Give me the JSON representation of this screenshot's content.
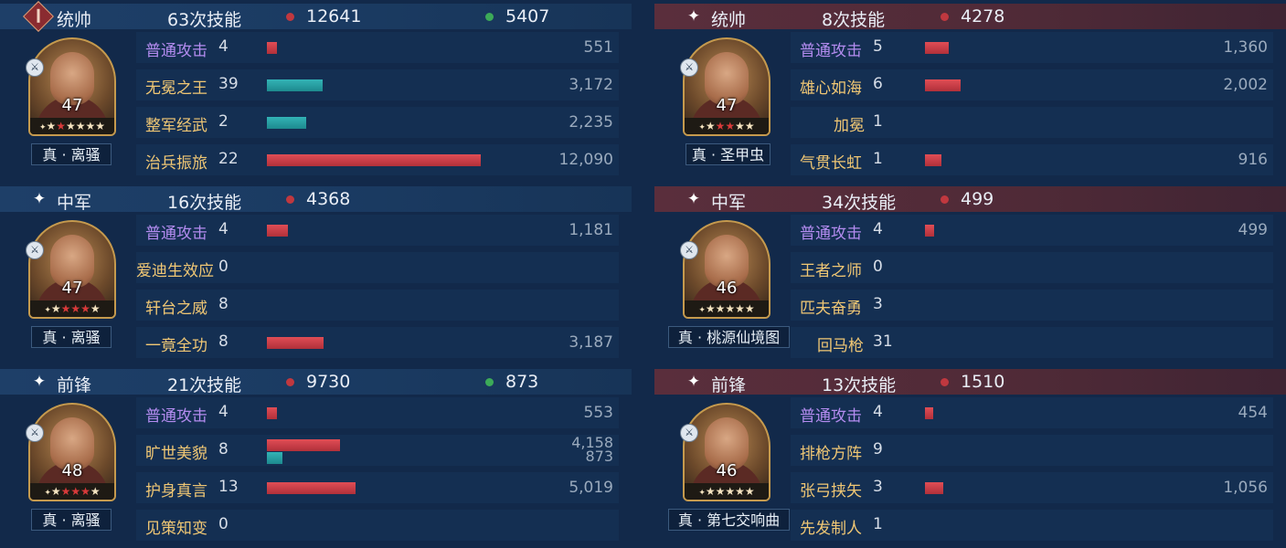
{
  "left": {
    "sections": [
      {
        "role": "统帅",
        "skill_count": "63次技能",
        "damage": "12641",
        "heal": "5407",
        "general": {
          "name": "真 · 离骚",
          "level": "47",
          "stars_red": 1,
          "stars_total": 6
        },
        "skills": [
          {
            "name": "普通攻击",
            "count": "4",
            "kind": "normal",
            "bars": [
              {
                "color": "red",
                "value": 551
              }
            ],
            "values": [
              "551"
            ]
          },
          {
            "name": "无冕之王",
            "count": "39",
            "kind": "tactic",
            "bars": [
              {
                "color": "teal",
                "value": 3172
              }
            ],
            "values": [
              "3,172"
            ]
          },
          {
            "name": "整军经武",
            "count": "2",
            "kind": "tactic",
            "bars": [
              {
                "color": "teal",
                "value": 2235
              }
            ],
            "values": [
              "2,235"
            ]
          },
          {
            "name": "治兵振旅",
            "count": "22",
            "kind": "tactic",
            "bars": [
              {
                "color": "red",
                "value": 12090
              }
            ],
            "values": [
              "12,090"
            ]
          }
        ]
      },
      {
        "role": "中军",
        "skill_count": "16次技能",
        "damage": "4368",
        "heal": "",
        "general": {
          "name": "真 · 离骚",
          "level": "47",
          "stars_red": 3,
          "stars_total": 5
        },
        "skills": [
          {
            "name": "普通攻击",
            "count": "4",
            "kind": "normal",
            "bars": [
              {
                "color": "red",
                "value": 1181
              }
            ],
            "values": [
              "1,181"
            ]
          },
          {
            "name": "爱迪生效应",
            "count": "0",
            "kind": "tactic",
            "bars": [],
            "values": []
          },
          {
            "name": "轩台之威",
            "count": "8",
            "kind": "tactic",
            "bars": [],
            "values": []
          },
          {
            "name": "一竟全功",
            "count": "8",
            "kind": "tactic",
            "bars": [
              {
                "color": "red",
                "value": 3187
              }
            ],
            "values": [
              "3,187"
            ]
          }
        ]
      },
      {
        "role": "前锋",
        "skill_count": "21次技能",
        "damage": "9730",
        "heal": "873",
        "general": {
          "name": "真 · 离骚",
          "level": "48",
          "stars_red": 3,
          "stars_total": 5
        },
        "skills": [
          {
            "name": "普通攻击",
            "count": "4",
            "kind": "normal",
            "bars": [
              {
                "color": "red",
                "value": 553
              }
            ],
            "values": [
              "553"
            ]
          },
          {
            "name": "旷世美貌",
            "count": "8",
            "kind": "tactic",
            "bars": [
              {
                "color": "red",
                "value": 4158
              },
              {
                "color": "teal",
                "value": 873
              }
            ],
            "values": [
              "4,158",
              "873"
            ]
          },
          {
            "name": "护身真言",
            "count": "13",
            "kind": "tactic",
            "bars": [
              {
                "color": "red",
                "value": 5019
              }
            ],
            "values": [
              "5,019"
            ]
          },
          {
            "name": "见策知变",
            "count": "0",
            "kind": "tactic",
            "bars": [],
            "values": []
          }
        ]
      }
    ]
  },
  "right": {
    "sections": [
      {
        "role": "统帅",
        "skill_count": "8次技能",
        "damage": "4278",
        "heal": "",
        "general": {
          "name": "真 · 圣甲虫",
          "level": "47",
          "stars_red": 2,
          "stars_total": 5
        },
        "skills": [
          {
            "name": "普通攻击",
            "count": "5",
            "kind": "normal",
            "bars": [
              {
                "color": "red",
                "value": 1360
              }
            ],
            "values": [
              "1,360"
            ]
          },
          {
            "name": "雄心如海",
            "count": "6",
            "kind": "tactic",
            "bars": [
              {
                "color": "red",
                "value": 2002
              }
            ],
            "values": [
              "2,002"
            ]
          },
          {
            "name": "加冕",
            "count": "1",
            "kind": "tactic",
            "bars": [],
            "values": []
          },
          {
            "name": "气贯长虹",
            "count": "1",
            "kind": "tactic",
            "bars": [
              {
                "color": "red",
                "value": 916
              }
            ],
            "values": [
              "916"
            ]
          }
        ]
      },
      {
        "role": "中军",
        "skill_count": "34次技能",
        "damage": "499",
        "heal": "",
        "general": {
          "name": "真 · 桃源仙境图",
          "level": "46",
          "stars_red": 0,
          "stars_total": 5
        },
        "skills": [
          {
            "name": "普通攻击",
            "count": "4",
            "kind": "normal",
            "bars": [
              {
                "color": "red",
                "value": 499
              }
            ],
            "values": [
              "499"
            ]
          },
          {
            "name": "王者之师",
            "count": "0",
            "kind": "tactic",
            "bars": [],
            "values": []
          },
          {
            "name": "匹夫奋勇",
            "count": "3",
            "kind": "tactic",
            "bars": [],
            "values": []
          },
          {
            "name": "回马枪",
            "count": "31",
            "kind": "tactic",
            "bars": [],
            "values": []
          }
        ]
      },
      {
        "role": "前锋",
        "skill_count": "13次技能",
        "damage": "1510",
        "heal": "",
        "general": {
          "name": "真 · 第七交响曲",
          "level": "46",
          "stars_red": 0,
          "stars_total": 5
        },
        "skills": [
          {
            "name": "普通攻击",
            "count": "4",
            "kind": "normal",
            "bars": [
              {
                "color": "red",
                "value": 454
              }
            ],
            "values": [
              "454"
            ]
          },
          {
            "name": "排枪方阵",
            "count": "9",
            "kind": "tactic",
            "bars": [],
            "values": []
          },
          {
            "name": "张弓挟矢",
            "count": "3",
            "kind": "tactic",
            "bars": [
              {
                "color": "red",
                "value": 1056
              }
            ],
            "values": [
              "1,056"
            ]
          },
          {
            "name": "先发制人",
            "count": "1",
            "kind": "tactic",
            "bars": [],
            "values": []
          }
        ]
      }
    ]
  },
  "colors": {
    "damage_bar": "#c9414a",
    "heal_bar": "#27a0a3",
    "normal_attack_label": "#b48cf0",
    "tactic_label": "#f0c774"
  },
  "icons": {
    "role_marker": "sparkle-icon",
    "commander_badge": "commander-badge-icon"
  }
}
